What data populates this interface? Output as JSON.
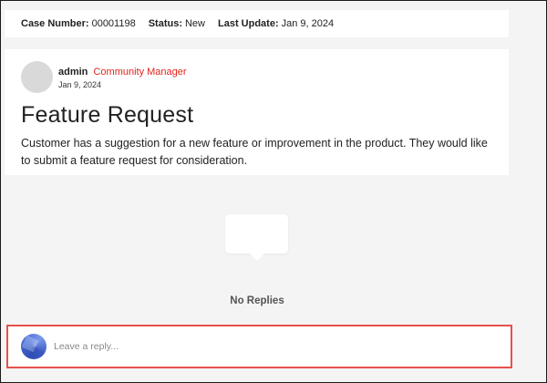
{
  "case": {
    "number_label": "Case Number:",
    "number_value": "00001198",
    "status_label": "Status:",
    "status_value": "New",
    "update_label": "Last Update:",
    "update_value": "Jan 9, 2024"
  },
  "post": {
    "author": "admin",
    "role": "Community Manager",
    "date": "Jan 9, 2024",
    "title": "Feature Request",
    "body": "Customer has a suggestion for a new feature or improvement in the product. They would like to submit a feature request for consideration."
  },
  "replies": {
    "empty_text": "No Replies",
    "icon": "speech-bubble-icon"
  },
  "reply_box": {
    "placeholder": "Leave a reply..."
  },
  "colors": {
    "role": "#e0241b",
    "reply_box_border": "#e6524b",
    "background": "#f4f4f4"
  }
}
